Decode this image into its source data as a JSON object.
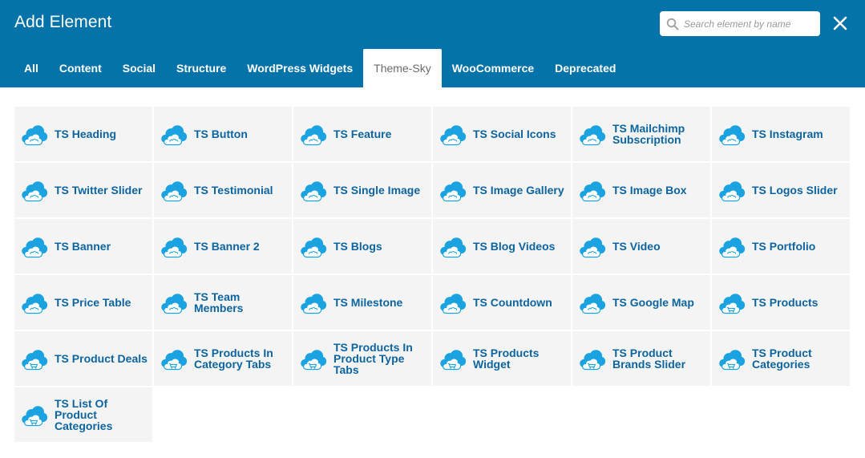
{
  "header": {
    "title": "Add Element",
    "search_placeholder": "Search element by name",
    "search_value": "",
    "close_icon": "close-icon"
  },
  "tabs": [
    {
      "label": "All",
      "active": false
    },
    {
      "label": "Content",
      "active": false
    },
    {
      "label": "Social",
      "active": false
    },
    {
      "label": "Structure",
      "active": false
    },
    {
      "label": "WordPress Widgets",
      "active": false
    },
    {
      "label": "Theme-Sky",
      "active": true
    },
    {
      "label": "WooCommerce",
      "active": false
    },
    {
      "label": "Deprecated",
      "active": false
    }
  ],
  "colors": {
    "header_bg": "#0473aa",
    "cell_bg": "#f4f4f4",
    "label_color": "#0c64a0",
    "icon_color": "#1aa3e0"
  },
  "elements": [
    {
      "label": "TS Heading",
      "icon": "cloud-icon"
    },
    {
      "label": "TS Button",
      "icon": "cloud-icon"
    },
    {
      "label": "TS Feature",
      "icon": "cloud-icon"
    },
    {
      "label": "TS Social Icons",
      "icon": "cloud-icon"
    },
    {
      "label": "TS Mailchimp Subscription",
      "icon": "cloud-icon"
    },
    {
      "label": "TS Instagram",
      "icon": "cloud-icon"
    },
    {
      "label": "TS Twitter Slider",
      "icon": "cloud-icon"
    },
    {
      "label": "TS Testimonial",
      "icon": "cloud-icon"
    },
    {
      "label": "TS Single Image",
      "icon": "cloud-icon"
    },
    {
      "label": "TS Image Gallery",
      "icon": "cloud-icon"
    },
    {
      "label": "TS Image Box",
      "icon": "cloud-icon"
    },
    {
      "label": "TS Logos Slider",
      "icon": "cloud-icon"
    },
    {
      "label": "TS Banner",
      "icon": "cloud-icon"
    },
    {
      "label": "TS Banner 2",
      "icon": "cloud-icon"
    },
    {
      "label": "TS Blogs",
      "icon": "cloud-icon"
    },
    {
      "label": "TS Blog Videos",
      "icon": "cloud-icon"
    },
    {
      "label": "TS Video",
      "icon": "cloud-icon"
    },
    {
      "label": "TS Portfolio",
      "icon": "cloud-icon"
    },
    {
      "label": "TS Price Table",
      "icon": "cloud-icon"
    },
    {
      "label": "TS Team Members",
      "icon": "cloud-icon"
    },
    {
      "label": "TS Milestone",
      "icon": "cloud-icon"
    },
    {
      "label": "TS Countdown",
      "icon": "cloud-icon"
    },
    {
      "label": "TS Google Map",
      "icon": "cloud-icon"
    },
    {
      "label": "TS Products",
      "icon": "cloud-cart-icon"
    },
    {
      "label": "TS Product Deals",
      "icon": "cloud-cart-icon"
    },
    {
      "label": "TS Products In Category Tabs",
      "icon": "cloud-cart-icon"
    },
    {
      "label": "TS Products In Product Type Tabs",
      "icon": "cloud-cart-icon"
    },
    {
      "label": "TS Products Widget",
      "icon": "cloud-cart-icon"
    },
    {
      "label": "TS Product Brands Slider",
      "icon": "cloud-cart-icon"
    },
    {
      "label": "TS Product Categories",
      "icon": "cloud-cart-icon"
    },
    {
      "label": "TS List Of Product Categories",
      "icon": "cloud-cart-icon"
    }
  ]
}
